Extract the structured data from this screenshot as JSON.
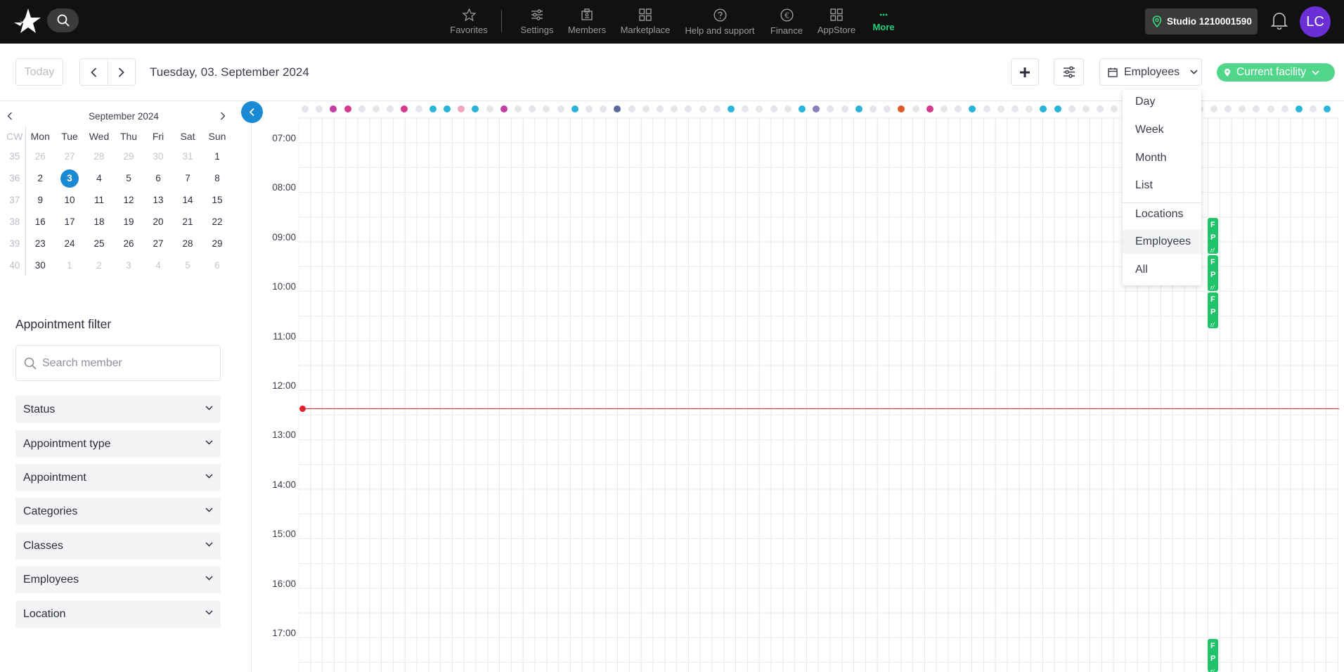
{
  "topnav": {
    "items": [
      {
        "label": "Favorites",
        "icon": "star-icon"
      },
      {
        "label": "Settings",
        "icon": "sliders-icon"
      },
      {
        "label": "Members",
        "icon": "id-card-icon"
      },
      {
        "label": "Marketplace",
        "icon": "grid-icon"
      },
      {
        "label": "Help and support",
        "icon": "question-icon"
      },
      {
        "label": "Finance",
        "icon": "euro-icon"
      },
      {
        "label": "AppStore",
        "icon": "apps-icon"
      },
      {
        "label": "More",
        "icon": "more-icon"
      }
    ],
    "active_color": "#21d07a",
    "studio_label": "Studio 1210001590",
    "avatar_initials": "LC",
    "avatar_color": "#6b2fd6"
  },
  "toolbar": {
    "today_label": "Today",
    "date_title": "Tuesday, 03. September 2024",
    "view_label": "Employees",
    "facility_label": "Current facility"
  },
  "mini_calendar": {
    "title": "September 2024",
    "cw_label": "CW",
    "weekdays": [
      "Mon",
      "Tue",
      "Wed",
      "Thu",
      "Fri",
      "Sat",
      "Sun"
    ],
    "weeks": [
      {
        "cw": "35",
        "days": [
          "26",
          "27",
          "28",
          "29",
          "30",
          "31",
          "1"
        ]
      },
      {
        "cw": "36",
        "days": [
          "2",
          "3",
          "4",
          "5",
          "6",
          "7",
          "8"
        ]
      },
      {
        "cw": "37",
        "days": [
          "9",
          "10",
          "11",
          "12",
          "13",
          "14",
          "15"
        ]
      },
      {
        "cw": "38",
        "days": [
          "16",
          "17",
          "18",
          "19",
          "20",
          "21",
          "22"
        ]
      },
      {
        "cw": "39",
        "days": [
          "23",
          "24",
          "25",
          "26",
          "27",
          "28",
          "29"
        ]
      },
      {
        "cw": "40",
        "days": [
          "30",
          "1",
          "2",
          "3",
          "4",
          "5",
          "6"
        ]
      }
    ],
    "selected_day": "3"
  },
  "filter": {
    "title": "Appointment filter",
    "search_placeholder": "Search member",
    "sections": [
      "Status",
      "Appointment type",
      "Appointment",
      "Categories",
      "Classes",
      "Employees",
      "Location"
    ]
  },
  "schedule": {
    "hours": [
      "07:00",
      "08:00",
      "09:00",
      "10:00",
      "11:00",
      "12:00",
      "13:00",
      "14:00",
      "15:00",
      "16:00",
      "17:00"
    ],
    "current_time_color": "#e2202a",
    "appointment_color": "#1ec36a"
  },
  "view_menu": {
    "items": [
      "Day",
      "Week",
      "Month",
      "List",
      "Locations",
      "Employees",
      "All"
    ],
    "highlighted": "Employees"
  },
  "appointment_blocks": [
    {
      "lines": [
        "F",
        "P",
        "r/"
      ]
    },
    {
      "lines": [
        "F",
        "P",
        "r/"
      ]
    },
    {
      "lines": [
        "F",
        "P",
        "r/"
      ]
    },
    {
      "lines": [
        "F",
        "P",
        "r/"
      ]
    }
  ]
}
